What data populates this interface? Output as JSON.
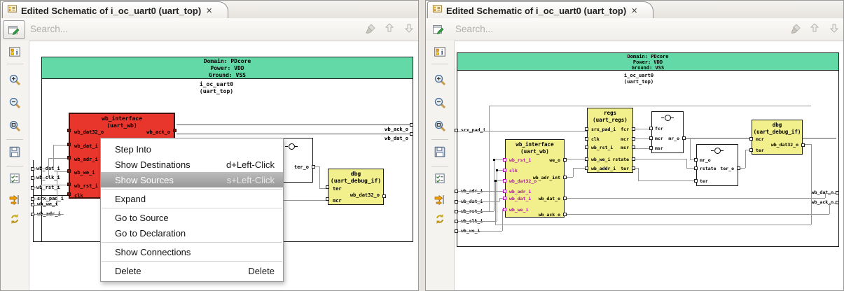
{
  "colors": {
    "domain_green": "#63d9a8",
    "selected_red": "#e8362c",
    "block_yellow": "#f2ef8d",
    "net_magenta": "#b40ab4"
  },
  "left_panel": {
    "tab_title": "Edited Schematic of i_oc_uart0 (uart_top)",
    "tab_close": "✕",
    "search_placeholder": "Search...",
    "schematic": {
      "domain": "Domain: PDcore",
      "power": "Power: VDD",
      "ground": "Ground: VSS",
      "instance": "i_oc_uart0",
      "module": "(uart_top)",
      "boundary_inputs": {
        "p0": "wb_dat_i",
        "p1": "wb_clk_i",
        "p2": "wb_rst_i",
        "p3": "srx_pad_i",
        "p4": "wb_we_i",
        "p5": "wb_adr_i"
      },
      "boundary_outputs": {
        "p0": "wb_ack_o",
        "p1": "wb_dat_o"
      },
      "wb_block": {
        "name": "wb_interface",
        "type": "(uart_wb)",
        "in0": "wb_dat32_o",
        "in1": "wb_dat_i",
        "in2": "wb_adr_i",
        "in3": "wb_we_i",
        "in4": "wb_rst_i",
        "in5": "clk",
        "out0": "wb_ack_o"
      },
      "gate_block": {
        "out0": "ter_o"
      },
      "dbg_block": {
        "name": "dbg",
        "type": "(uart_debug_if)",
        "in0": "ter",
        "in1": "mcr",
        "out0": "wb_dat32_o"
      }
    },
    "context_menu": {
      "step_into": "Step Into",
      "show_destinations": "Show Destinations",
      "show_destinations_shortcut": "d+Left-Click",
      "show_sources": "Show Sources",
      "show_sources_shortcut": "s+Left-Click",
      "expand": "Expand",
      "go_to_source": "Go to Source",
      "go_to_declaration": "Go to Declaration",
      "show_connections": "Show Connections",
      "delete_label": "Delete",
      "delete_shortcut": "Delete"
    }
  },
  "right_panel": {
    "tab_title": "Edited Schematic of i_oc_uart0 (uart_top)",
    "tab_close": "✕",
    "search_placeholder": "Search...",
    "schematic": {
      "domain": "Domain: PDcore",
      "power": "Power: VDD",
      "ground": "Ground: VSS",
      "instance": "i_oc_uart0",
      "module": "(uart_top)",
      "boundary_inputs": {
        "p0": "srx_pad_i",
        "p1": "wb_adr_i",
        "p2": "wb_dat_i",
        "p3": "wb_rst_i",
        "p4": "wb_clk_i",
        "p5": "wb_we_i"
      },
      "boundary_outputs": {
        "p0": "wb_dat_o",
        "p1": "wb_ack_o"
      },
      "regs_block": {
        "name": "regs",
        "type": "(uart_regs)",
        "in0": "srx_pad_i",
        "in1": "clk",
        "in2": "wb_rst_i",
        "in3": "wb_we_i",
        "in4": "wb_addr_i",
        "out0": "fcr",
        "out1": "mcr",
        "out2": "msr",
        "out3": "rstate",
        "out4": "ter"
      },
      "gate1_block": {
        "in0": "fcr",
        "in1": "mcr",
        "in2": "msr",
        "out0": "mr_o"
      },
      "gate2_block": {
        "in0": "mr_o",
        "in1": "rstate",
        "in2": "ter",
        "out0": "ter_o"
      },
      "wb_block": {
        "name": "wb_interface",
        "type": "(uart_wb)",
        "in0": "wb_rst_i",
        "in1": "clk",
        "in2": "wb_dat32_o",
        "in3": "wb_adr_i",
        "in4": "wb_dat_i",
        "in5": "wb_we_i",
        "out0": "we_o",
        "out1": "wb_adr_int",
        "out2": "wb_dat_o",
        "out3": "wb_ack_o"
      },
      "dbg_block": {
        "name": "dbg",
        "type": "(uart_debug_if)",
        "in0": "mcr",
        "in1": "ter",
        "out0": "wb_dat32_o"
      }
    }
  }
}
